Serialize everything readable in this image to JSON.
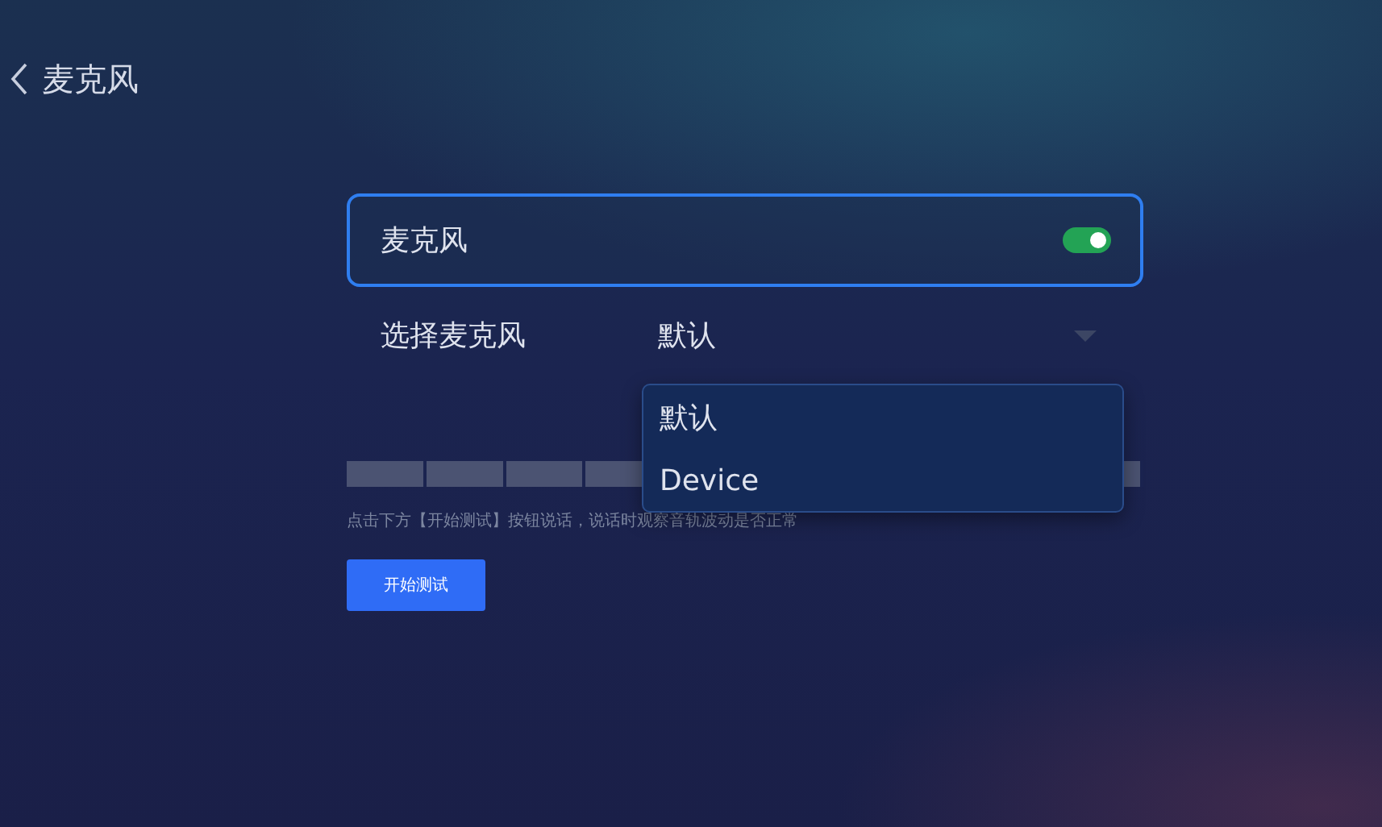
{
  "header": {
    "title": "麦克风"
  },
  "toggle_row": {
    "label": "麦克风",
    "on": true
  },
  "select_row": {
    "label": "选择麦克风",
    "value": "默认",
    "expanded": true
  },
  "dropdown": {
    "options": [
      {
        "label": "默认",
        "selected": false
      },
      {
        "label": "Device",
        "selected": false
      }
    ]
  },
  "meter": {
    "level": 0
  },
  "hint": "点击下方【开始测试】按钮说话，说话时观察音轨波动是否正常",
  "test_button": {
    "label": "开始测试"
  }
}
